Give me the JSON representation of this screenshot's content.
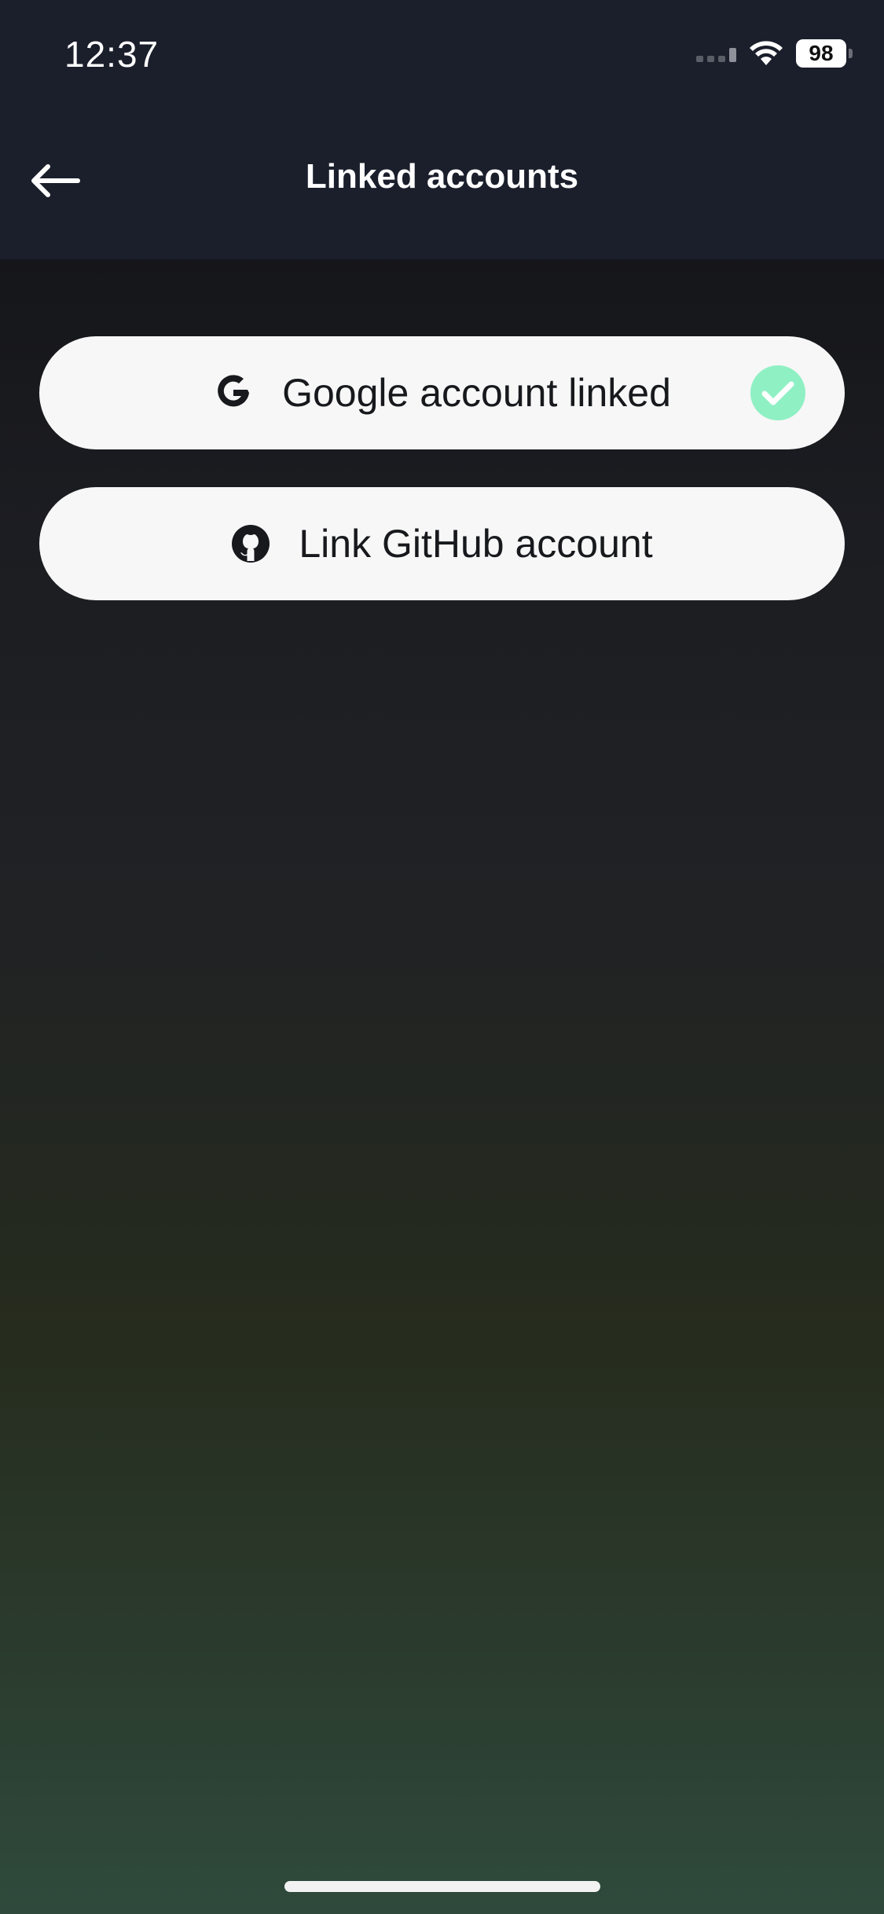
{
  "status_bar": {
    "time": "12:37",
    "battery": "98"
  },
  "header": {
    "title": "Linked accounts",
    "back_icon": "arrow-left-icon"
  },
  "accounts": {
    "google": {
      "label": "Google account linked",
      "icon": "google-icon",
      "status_icon": "check-circle-icon",
      "linked": true
    },
    "github": {
      "label": "Link GitHub account",
      "icon": "github-icon",
      "linked": false
    }
  },
  "colors": {
    "header_bg": "#1b1f2c",
    "button_bg": "#f7f7f7",
    "check_badge": "#8ff0c4",
    "text_dark": "#17191d"
  }
}
